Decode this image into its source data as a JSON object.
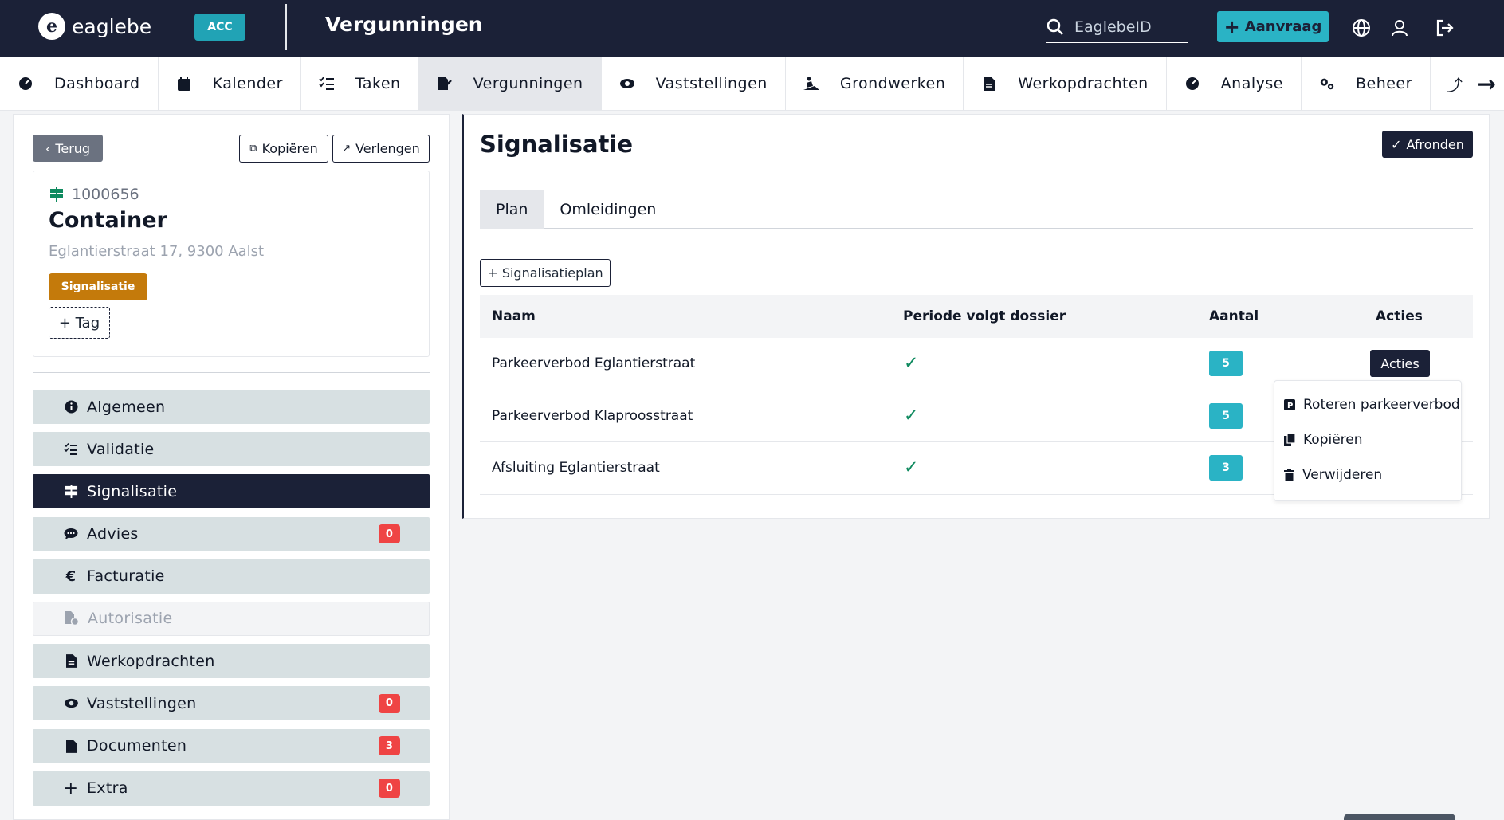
{
  "header": {
    "logo_text": "eaglebe",
    "env_badge": "ACC",
    "app_title": "Vergunningen",
    "search_placeholder": "EaglebeID",
    "new_button": "Aanvraag"
  },
  "nav": {
    "items": [
      {
        "label": "Dashboard",
        "icon": "dashboard-icon"
      },
      {
        "label": "Kalender",
        "icon": "calendar-icon"
      },
      {
        "label": "Taken",
        "icon": "tasks-icon"
      },
      {
        "label": "Vergunningen",
        "icon": "permit-icon",
        "active": true
      },
      {
        "label": "Vaststellingen",
        "icon": "eye-icon"
      },
      {
        "label": "Grondwerken",
        "icon": "digging-icon"
      },
      {
        "label": "Werkopdrachten",
        "icon": "document-icon"
      },
      {
        "label": "Analyse",
        "icon": "chart-icon"
      },
      {
        "label": "Beheer",
        "icon": "cogs-icon"
      }
    ]
  },
  "sidebar": {
    "back_label": "Terug",
    "copy_label": "Kopiëren",
    "extend_label": "Verlengen",
    "permit_id": "1000656",
    "permit_title": "Container",
    "permit_address": "Eglantierstraat 17, 9300 Aalst",
    "tag": "Signalisatie",
    "add_tag_label": "+ Tag",
    "menu": [
      {
        "label": "Algemeen",
        "icon": "info-icon"
      },
      {
        "label": "Validatie",
        "icon": "checklist-icon"
      },
      {
        "label": "Signalisatie",
        "icon": "signpost-icon",
        "active": true
      },
      {
        "label": "Advies",
        "icon": "chat-icon",
        "count": "0"
      },
      {
        "label": "Facturatie",
        "icon": "euro-icon"
      },
      {
        "label": "Autorisatie",
        "icon": "authorization-icon",
        "disabled": true
      },
      {
        "label": "Werkopdrachten",
        "icon": "document-icon"
      },
      {
        "label": "Vaststellingen",
        "icon": "eye-icon",
        "count": "0"
      },
      {
        "label": "Documenten",
        "icon": "file-icon",
        "count": "3"
      },
      {
        "label": "Extra",
        "icon": "plus-icon",
        "count": "0"
      }
    ]
  },
  "main": {
    "title": "Signalisatie",
    "finish_label": "Afronden",
    "tabs": [
      "Plan",
      "Omleidingen"
    ],
    "add_plan_label": "+ Signalisatieplan",
    "table": {
      "headers": [
        "Naam",
        "Periode volgt dossier",
        "Aantal",
        "Acties"
      ],
      "rows": [
        {
          "name": "Parkeerverbod Eglantierstraat",
          "follows": true,
          "count": "5",
          "action": "Acties"
        },
        {
          "name": "Parkeerverbod Klaproosstraat",
          "follows": true,
          "count": "5"
        },
        {
          "name": "Afsluiting Eglantierstraat",
          "follows": true,
          "count": "3"
        }
      ]
    },
    "dropdown": [
      "Roteren parkeerverbod",
      "Kopiëren",
      "Verwijderen"
    ]
  },
  "colors": {
    "navy": "#1b2137",
    "teal": "#2ab3c5",
    "tag_orange": "#c47a0b",
    "badge_red": "#ef4444",
    "check_green": "#0f8a5f"
  }
}
